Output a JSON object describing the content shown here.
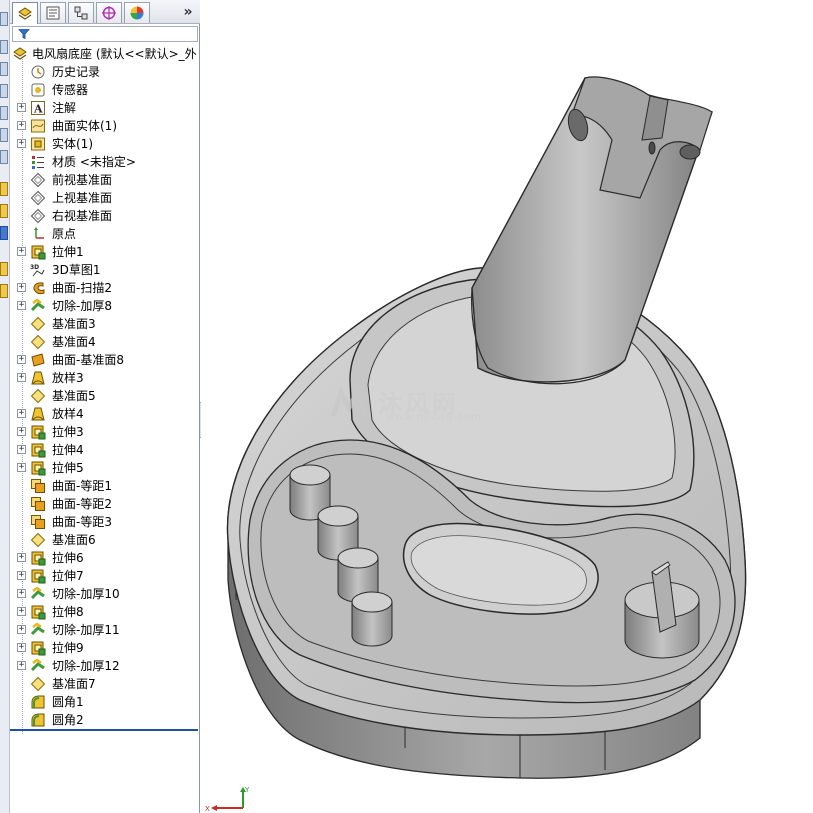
{
  "panel": {
    "tabs": [
      {
        "name": "featuremanager-tab",
        "icon": "featuremanager-icon"
      },
      {
        "name": "propertymanager-tab",
        "icon": "propertymanager-icon"
      },
      {
        "name": "configurationmanager-tab",
        "icon": "configurationmanager-icon"
      },
      {
        "name": "dimxpertmanager-tab",
        "icon": "dimxpert-icon"
      },
      {
        "name": "displaymanager-tab",
        "icon": "displaymanager-icon"
      }
    ],
    "more_glyph": "»",
    "root_label": "电风扇底座  (默认<<默认>_外"
  },
  "tree_items": [
    {
      "label": "历史记录",
      "icon": "history-icon",
      "expandable": false
    },
    {
      "label": "传感器",
      "icon": "sensors-icon",
      "expandable": false
    },
    {
      "label": "注解",
      "icon": "annotations-icon",
      "expandable": true
    },
    {
      "label": "曲面实体(1)",
      "icon": "surface-bodies-icon",
      "expandable": true
    },
    {
      "label": "实体(1)",
      "icon": "solid-bodies-icon",
      "expandable": true
    },
    {
      "label": "材质 <未指定>",
      "icon": "material-icon",
      "expandable": false
    },
    {
      "label": "前视基准面",
      "icon": "plane-icon",
      "expandable": false
    },
    {
      "label": "上视基准面",
      "icon": "plane-icon",
      "expandable": false
    },
    {
      "label": "右视基准面",
      "icon": "plane-icon",
      "expandable": false
    },
    {
      "label": "原点",
      "icon": "origin-icon",
      "expandable": false
    },
    {
      "label": "拉伸1",
      "icon": "extrude-icon",
      "expandable": true
    },
    {
      "label": "3D草图1",
      "icon": "3d-sketch-icon",
      "expandable": false
    },
    {
      "label": "曲面-扫描2",
      "icon": "surface-sweep-icon",
      "expandable": true
    },
    {
      "label": "切除-加厚8",
      "icon": "cut-thicken-icon",
      "expandable": true
    },
    {
      "label": "基准面3",
      "icon": "ref-plane-icon",
      "expandable": false
    },
    {
      "label": "基准面4",
      "icon": "ref-plane-icon",
      "expandable": false
    },
    {
      "label": "曲面-基准面8",
      "icon": "planar-surface-icon",
      "expandable": true
    },
    {
      "label": "放样3",
      "icon": "loft-icon",
      "expandable": true
    },
    {
      "label": "基准面5",
      "icon": "ref-plane-icon",
      "expandable": false
    },
    {
      "label": "放样4",
      "icon": "loft-icon",
      "expandable": true
    },
    {
      "label": "拉伸3",
      "icon": "extrude-icon",
      "expandable": true
    },
    {
      "label": "拉伸4",
      "icon": "extrude-icon",
      "expandable": true
    },
    {
      "label": "拉伸5",
      "icon": "extrude-icon",
      "expandable": true
    },
    {
      "label": "曲面-等距1",
      "icon": "offset-surface-icon",
      "expandable": false
    },
    {
      "label": "曲面-等距2",
      "icon": "offset-surface-icon",
      "expandable": false
    },
    {
      "label": "曲面-等距3",
      "icon": "offset-surface-icon",
      "expandable": false
    },
    {
      "label": "基准面6",
      "icon": "ref-plane-icon",
      "expandable": false
    },
    {
      "label": "拉伸6",
      "icon": "extrude-icon",
      "expandable": true
    },
    {
      "label": "拉伸7",
      "icon": "extrude-icon",
      "expandable": true
    },
    {
      "label": "切除-加厚10",
      "icon": "cut-thicken-icon",
      "expandable": true
    },
    {
      "label": "拉伸8",
      "icon": "extrude-icon",
      "expandable": true
    },
    {
      "label": "切除-加厚11",
      "icon": "cut-thicken-icon",
      "expandable": true
    },
    {
      "label": "拉伸9",
      "icon": "extrude-icon",
      "expandable": true
    },
    {
      "label": "切除-加厚12",
      "icon": "cut-thicken-icon",
      "expandable": true
    },
    {
      "label": "基准面7",
      "icon": "ref-plane-icon",
      "expandable": false
    },
    {
      "label": "圆角1",
      "icon": "fillet-icon",
      "expandable": false
    },
    {
      "label": "圆角2",
      "icon": "fillet-icon",
      "expandable": false
    }
  ],
  "watermark": {
    "text": "沐风网",
    "subtext": "www.mfcad.com"
  },
  "model": {
    "name": "fan-base-model",
    "colors": {
      "face": "#c9c9c9",
      "face_light": "#d8d8d8",
      "face_dark": "#8a8a8a",
      "edge": "#2a2a2a"
    }
  },
  "triad": {
    "x_label": "X",
    "y_label": "Y"
  },
  "colors": {
    "accent": "#1f4fa8",
    "extrude": "#e8b81a",
    "cut": "#3c9a3c",
    "panel_border": "#8b96a8"
  }
}
